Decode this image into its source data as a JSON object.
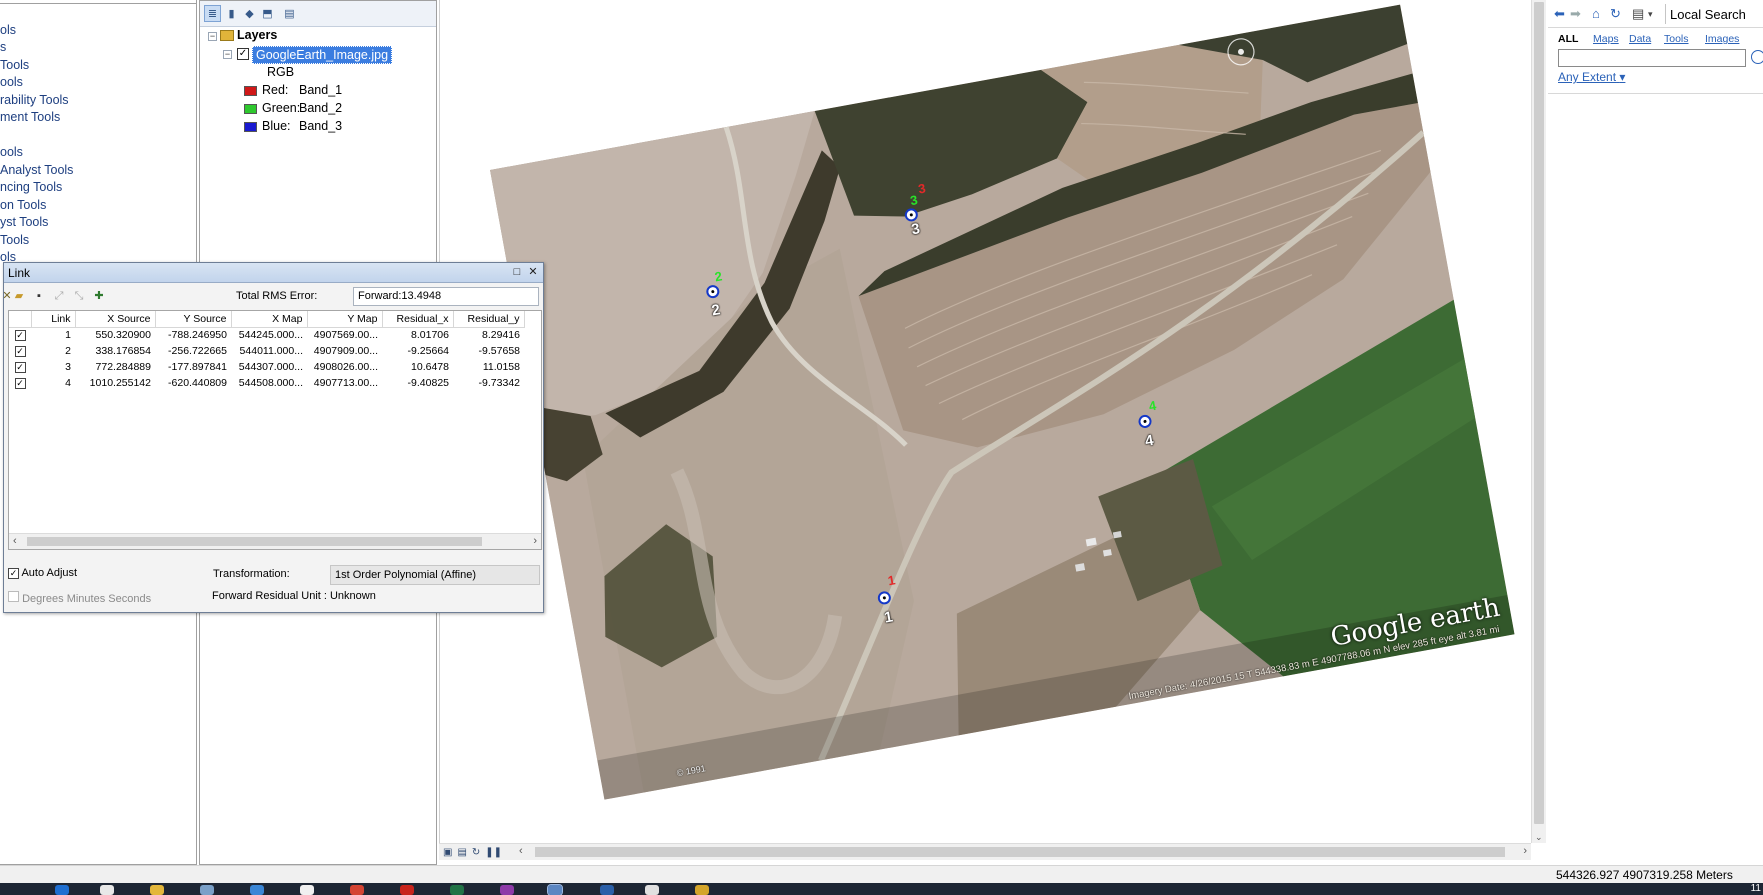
{
  "toolbox": {
    "items": [
      "ols",
      "s",
      "Tools",
      "ools",
      "rability Tools",
      "ment Tools",
      "ools",
      " Analyst Tools",
      "ncing Tools",
      "on Tools",
      "yst Tools",
      "Tools",
      "ols"
    ]
  },
  "toc": {
    "layers_label": "Layers",
    "layer_name": "GoogleEarth_Image.jpg",
    "rgb_label": "RGB",
    "bands": [
      {
        "channel": "Red:",
        "band": "Band_1",
        "color": "#d01818"
      },
      {
        "channel": "Green:",
        "band": "Band_2",
        "color": "#2ec82e"
      },
      {
        "channel": "Blue:",
        "band": "Band_3",
        "color": "#1a1ad0"
      }
    ]
  },
  "map": {
    "watermark": "Google earth",
    "imagery_date": "Imagery Date: 4/26/2015    15 T 544338.83 m E 4907788.06 m N elev 285 ft    eye alt 3.81 mi",
    "copyright": "© 1991",
    "gcps": [
      {
        "green": "1",
        "red": "",
        "label": "1"
      },
      {
        "green": "2",
        "red": "",
        "label": "2"
      },
      {
        "green": "3",
        "red": "3",
        "label": "3"
      },
      {
        "green": "4",
        "red": "",
        "label": "4"
      }
    ]
  },
  "link_window": {
    "title": "Link",
    "rms_label": "Total RMS Error:",
    "rms_value": "Forward:13.4948",
    "columns": [
      "Link",
      "X Source",
      "Y Source",
      "X Map",
      "Y Map",
      "Residual_x",
      "Residual_y"
    ],
    "rows": [
      {
        "checked": true,
        "link": "1",
        "x_source": "550.320900",
        "y_source": "-788.246950",
        "x_map": "544245.000...",
        "y_map": "4907569.00...",
        "residual_x": "8.01706",
        "residual_y": "8.29416"
      },
      {
        "checked": true,
        "link": "2",
        "x_source": "338.176854",
        "y_source": "-256.722665",
        "x_map": "544011.000...",
        "y_map": "4907909.00...",
        "residual_x": "-9.25664",
        "residual_y": "-9.57658"
      },
      {
        "checked": true,
        "link": "3",
        "x_source": "772.284889",
        "y_source": "-177.897841",
        "x_map": "544307.000...",
        "y_map": "4908026.00...",
        "residual_x": "10.6478",
        "residual_y": "11.0158"
      },
      {
        "checked": true,
        "link": "4",
        "x_source": "1010.255142",
        "y_source": "-620.440809",
        "x_map": "544508.000...",
        "y_map": "4907713.00...",
        "residual_x": "-9.40825",
        "residual_y": "-9.73342"
      }
    ],
    "auto_adjust_label": "Auto Adjust",
    "auto_adjust_checked": true,
    "transformation_label": "Transformation:",
    "transformation_value": "1st Order Polynomial (Affine)",
    "dms_label": "Degrees Minutes Seconds",
    "residual_unit": "Forward Residual Unit : Unknown"
  },
  "search_panel": {
    "title": "Local Search",
    "tabs": [
      "ALL",
      "Maps",
      "Data",
      "Tools",
      "Images"
    ],
    "active_tab": "ALL",
    "query": "",
    "extent_label": "Any Extent"
  },
  "status": {
    "coordinates": "544326.927  4907319.258 Meters"
  },
  "taskbar": {
    "clock": "11"
  }
}
